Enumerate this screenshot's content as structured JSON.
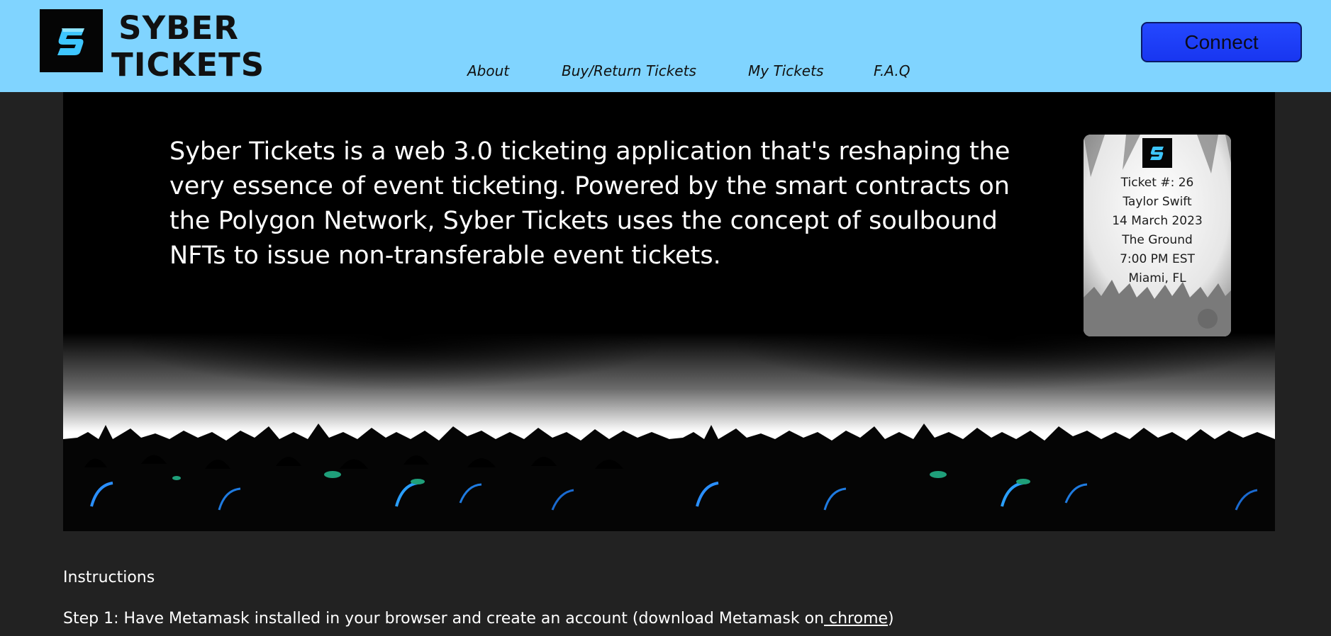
{
  "brand": {
    "line1": "SYBER",
    "line2": "TICKETS",
    "logo_icon": "s-logo-icon",
    "logo_color": "#3ec6ff"
  },
  "nav": {
    "items": [
      {
        "label": "About"
      },
      {
        "label": "Buy/Return Tickets"
      },
      {
        "label": "My Tickets"
      },
      {
        "label": "F.A.Q"
      }
    ]
  },
  "header": {
    "connect_label": "Connect",
    "background": "#80d4ff",
    "button_color": "#2448ff"
  },
  "hero": {
    "description": "Syber Tickets is a web 3.0 ticketing application that's reshaping the very essence of event ticketing. Powered by the smart contracts on the Polygon Network, Syber Tickets uses the concept of soulbound NFTs to issue non-transferable event tickets."
  },
  "ticket": {
    "number": "Ticket #: 26",
    "artist": "Taylor Swift",
    "date": "14 March 2023",
    "venue": "The Ground",
    "time": "7:00 PM EST",
    "location": "Miami, FL"
  },
  "instructions": {
    "title": "Instructions",
    "step1_text": "Step 1: Have Metamask installed in your browser and create an account (download Metamask on",
    "step1_link": " chrome",
    "step1_close": ")"
  }
}
